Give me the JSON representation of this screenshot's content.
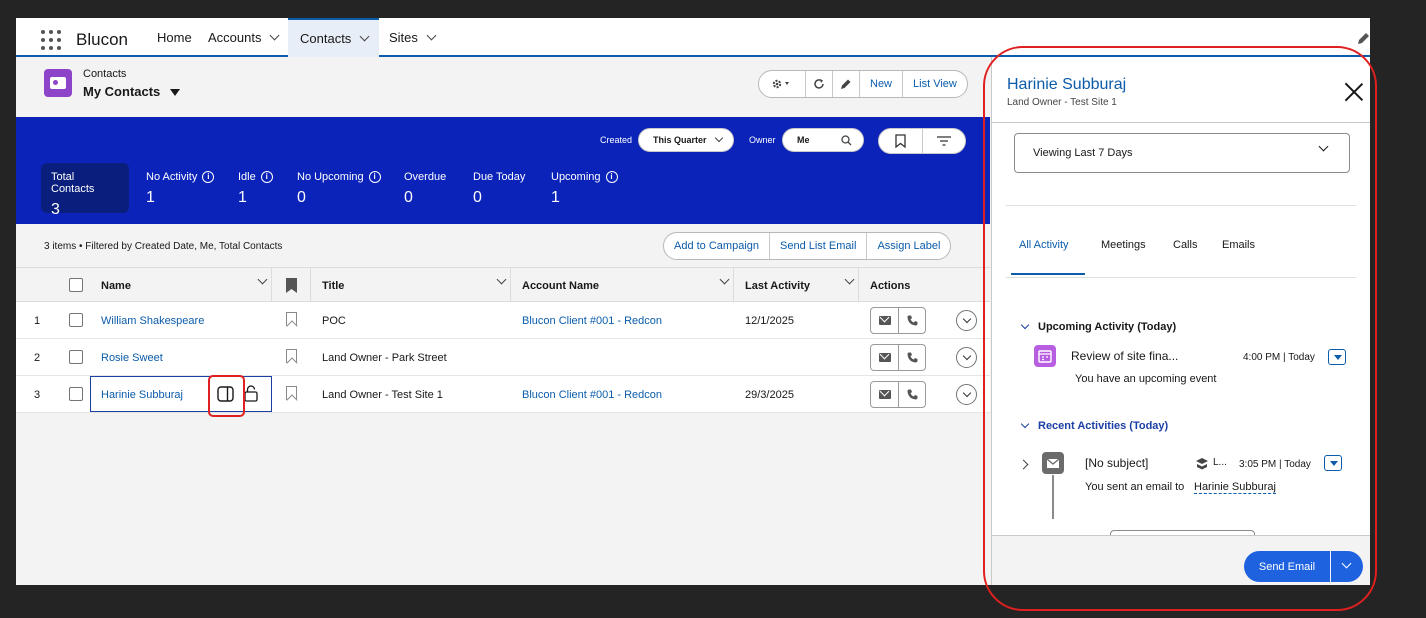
{
  "nav": {
    "app_name": "Blucon",
    "tabs": [
      {
        "label": "Home",
        "dropdown": false
      },
      {
        "label": "Accounts",
        "dropdown": true
      },
      {
        "label": "Contacts",
        "dropdown": true,
        "active": true
      },
      {
        "label": "Sites",
        "dropdown": true
      }
    ]
  },
  "list_header": {
    "object_label": "Contacts",
    "view_label": "My Contacts",
    "buttons": {
      "new": "New",
      "list_view": "List View"
    }
  },
  "filters": {
    "created_label": "Created",
    "created_value": "This Quarter",
    "owner_label": "Owner",
    "owner_value": "Me"
  },
  "kpis": [
    {
      "label": "Total Contacts",
      "value": "3",
      "info": false,
      "selected": true
    },
    {
      "label": "No Activity",
      "value": "1",
      "info": true
    },
    {
      "label": "Idle",
      "value": "1",
      "info": true
    },
    {
      "label": "No Upcoming",
      "value": "0",
      "info": true
    },
    {
      "label": "Overdue",
      "value": "0",
      "info": false
    },
    {
      "label": "Due Today",
      "value": "0",
      "info": false
    },
    {
      "label": "Upcoming",
      "value": "1",
      "info": true
    }
  ],
  "status_text": "3 items • Filtered by Created Date, Me, Total Contacts",
  "bulk_actions": {
    "add_to_campaign": "Add to Campaign",
    "send_list_email": "Send List Email",
    "assign_label": "Assign Label"
  },
  "table": {
    "columns": {
      "name": "Name",
      "title": "Title",
      "account": "Account Name",
      "last_activity": "Last Activity",
      "actions": "Actions"
    },
    "rows": [
      {
        "num": "1",
        "name": "William Shakespeare",
        "title": "POC",
        "account": "Blucon Client #001 - Redcon",
        "last_activity": "12/1/2025"
      },
      {
        "num": "2",
        "name": "Rosie Sweet",
        "title": "Land Owner - Park Street",
        "account": "",
        "last_activity": ""
      },
      {
        "num": "3",
        "name": "Harinie Subburaj",
        "title": "Land Owner - Test Site 1",
        "account": "Blucon Client #001 - Redcon",
        "last_activity": "29/3/2025"
      }
    ]
  },
  "panel": {
    "name": "Harinie Subburaj",
    "subtitle": "Land Owner - Test Site 1",
    "filter_value": "Viewing Last 7 Days",
    "tabs": [
      "All Activity",
      "Meetings",
      "Calls",
      "Emails"
    ],
    "upcoming": {
      "heading": "Upcoming Activity (Today)",
      "item_title": "Review of site fina...",
      "item_time": "4:00 PM | Today",
      "item_desc": "You have an upcoming event"
    },
    "recent": {
      "heading": "Recent Activities (Today)",
      "item_title": "[No subject]",
      "item_owner": "L...",
      "item_time": "3:05 PM | Today",
      "item_desc": "You sent an email to",
      "item_link": "Harinie Subburaj"
    },
    "send_email": "Send Email"
  },
  "colors": {
    "brand_blue": "#0b5cab",
    "kpi_band": "#0b23b9",
    "annotation_red": "#e02020"
  }
}
